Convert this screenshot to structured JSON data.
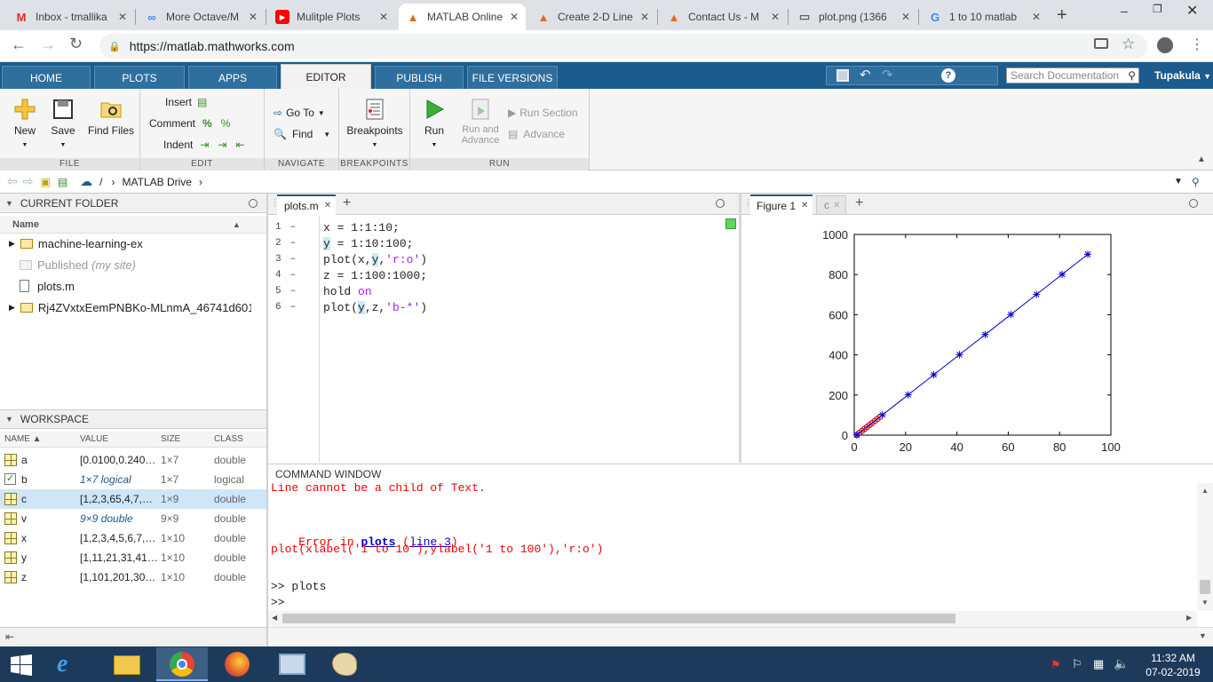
{
  "browser": {
    "tabs": [
      {
        "title": "Inbox - tmallika",
        "icon": "gmail-icon",
        "color": "#d93025"
      },
      {
        "title": "More Octave/M",
        "icon": "link-icon",
        "color": "#4285f4"
      },
      {
        "title": "Mulitple Plots",
        "icon": "youtube-icon",
        "color": "#ff0000"
      },
      {
        "title": "MATLAB Online",
        "icon": "matlab-icon",
        "color": "#e16a1f"
      },
      {
        "title": "Create 2-D Line",
        "icon": "matlab-icon",
        "color": "#e16a1f"
      },
      {
        "title": "Contact Us - M",
        "icon": "matlab-icon",
        "color": "#e16a1f"
      },
      {
        "title": "plot.png (1366",
        "icon": "file-icon",
        "color": "#5f6368"
      },
      {
        "title": "1 to 10 matlab",
        "icon": "google-icon",
        "color": "#4285f4"
      }
    ],
    "url": "https://matlab.mathworks.com"
  },
  "toolstrip": {
    "tabs": [
      "HOME",
      "PLOTS",
      "APPS",
      "EDITOR",
      "PUBLISH",
      "FILE VERSIONS"
    ],
    "search_placeholder": "Search Documentation",
    "user": "Tupakula"
  },
  "ribbon": {
    "file": {
      "new": "New",
      "save": "Save",
      "find_files": "Find Files",
      "label": "FILE"
    },
    "edit": {
      "insert": "Insert",
      "comment": "Comment",
      "indent": "Indent",
      "label": "EDIT"
    },
    "navigate": {
      "goto": "Go To",
      "find": "Find",
      "label": "NAVIGATE"
    },
    "breakpoints": {
      "btn": "Breakpoints",
      "label": "BREAKPOINTS"
    },
    "run": {
      "run": "Run",
      "run_advance": "Run and",
      "run_advance2": "Advance",
      "run_section": "Run Section",
      "advance": "Advance",
      "label": "RUN"
    }
  },
  "pathbar": {
    "sep": "/",
    "folder": "MATLAB Drive"
  },
  "current_folder": {
    "title": "CURRENT FOLDER",
    "col_name": "Name",
    "items": [
      {
        "name": "machine-learning-ex",
        "type": "folder"
      },
      {
        "name": "Published",
        "note": "(my site)",
        "type": "published"
      },
      {
        "name": "plots.m",
        "type": "file"
      },
      {
        "name": "Rj4ZVxtxEemPNBKo-MLnmA_46741d601",
        "type": "folder"
      }
    ]
  },
  "workspace": {
    "title": "WORKSPACE",
    "cols": [
      "NAME ▲",
      "VALUE",
      "SIZE",
      "CLASS"
    ],
    "rows": [
      {
        "name": "a",
        "value": "[0.0100,0.240…",
        "size": "1×7",
        "class": "double"
      },
      {
        "name": "b",
        "value": "1×7 logical",
        "size": "1×7",
        "class": "logical"
      },
      {
        "name": "c",
        "value": "[1,2,3,65,4,7,…",
        "size": "1×9",
        "class": "double"
      },
      {
        "name": "v",
        "value": "9×9 double",
        "size": "9×9",
        "class": "double"
      },
      {
        "name": "x",
        "value": "[1,2,3,4,5,6,7,…",
        "size": "1×10",
        "class": "double"
      },
      {
        "name": "y",
        "value": "[1,11,21,31,41…",
        "size": "1×10",
        "class": "double"
      },
      {
        "name": "z",
        "value": "[1,101,201,30…",
        "size": "1×10",
        "class": "double"
      }
    ]
  },
  "editor": {
    "tab": "plots.m",
    "lines": [
      {
        "n": "1",
        "dash": "–",
        "code": "x = 1:1:10;"
      },
      {
        "n": "2",
        "dash": "–",
        "code": "y = 1:10:100;"
      },
      {
        "n": "3",
        "dash": "–",
        "code": "plot(x,y,'r:o')"
      },
      {
        "n": "4",
        "dash": "–",
        "code": "z = 1:100:1000;"
      },
      {
        "n": "5",
        "dash": "–",
        "code": "hold on"
      },
      {
        "n": "6",
        "dash": "–",
        "code": "plot(y,z,'b-*')"
      }
    ]
  },
  "figure": {
    "tab1": "Figure 1",
    "tab2": "c"
  },
  "chart_data": {
    "type": "line",
    "xlim": [
      0,
      100
    ],
    "ylim": [
      0,
      1000
    ],
    "xticks": [
      0,
      20,
      40,
      60,
      80,
      100
    ],
    "yticks": [
      0,
      200,
      400,
      600,
      800,
      1000
    ],
    "series": [
      {
        "style": "r:o",
        "color": "#cc0000",
        "x": [
          1,
          2,
          3,
          4,
          5,
          6,
          7,
          8,
          9,
          10
        ],
        "y": [
          1,
          11,
          21,
          31,
          41,
          51,
          61,
          71,
          81,
          91
        ]
      },
      {
        "style": "b-*",
        "color": "#0000cc",
        "x": [
          1,
          11,
          21,
          31,
          41,
          51,
          61,
          71,
          81,
          91
        ],
        "y": [
          1,
          101,
          201,
          301,
          401,
          501,
          601,
          701,
          801,
          901
        ]
      }
    ]
  },
  "command_window": {
    "title": "COMMAND WINDOW",
    "err1": "Line cannot be a child of Text.",
    "err2a": "Error in ",
    "err2b": "plots",
    "err2c": " (",
    "err2d": "line 3",
    "err2e": ")",
    "err3": "plot(xlabel('1 to 10'),ylabel('1 to 100'),'r:o')",
    "prompt1": ">> plots",
    "prompt2": ">>"
  },
  "taskbar": {
    "time": "11:32 AM",
    "date": "07-02-2019"
  }
}
